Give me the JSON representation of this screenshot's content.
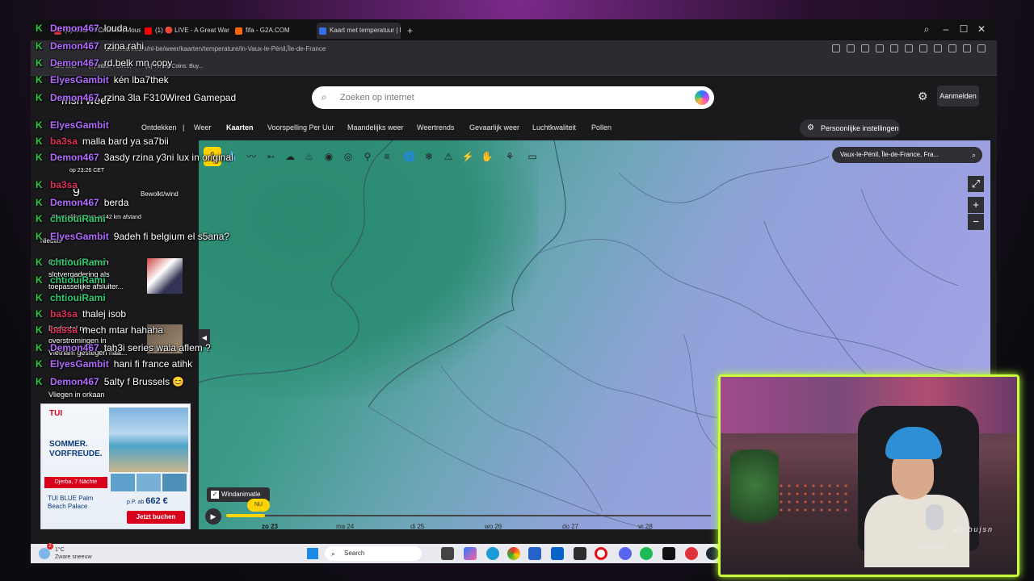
{
  "browser": {
    "tabs": [
      {
        "label": "(1) Deal Of Crashes, Mouse",
        "color": "#c33"
      },
      {
        "label": "(1) 🔴 LIVE - A Great War",
        "color": "#f00"
      },
      {
        "label": "fifa - G2A.COM",
        "color": "#f60"
      },
      {
        "label": "Kaart met temperatuur | M",
        "color": "#3a6ee8"
      }
    ],
    "url": "www.msn.com/nl-be/weer/kaarten/temperature/in-Vaux-le-Pénil,Île-de-France",
    "bookmarks": [
      "safe deal",
      "(7) Inbox • Direct",
      "(6) TikTok Coins: Buy..."
    ],
    "window_controls": [
      "search-icon",
      "minimize-icon",
      "maximize-icon",
      "close-icon"
    ]
  },
  "msn": {
    "logo_text": "msn weer",
    "search_placeholder": "Zoeken op internet",
    "signin_label": "Aanmelden",
    "personal_settings": "Persoonlijke instellingen",
    "nav": [
      "Ontdekken",
      "Weer",
      "Kaarten",
      "Voorspelling Per Uur",
      "Maandelijks weer",
      "Weertrends",
      "Gevaarlijk weer",
      "Luchtkwaliteit",
      "Pollen"
    ],
    "active_nav": "Kaarten"
  },
  "map": {
    "location": "Vaux-le-Pénil, Île-de-France, Fra...",
    "tools": [
      "thermometer-icon",
      "droplet-icon",
      "wind-icon",
      "wind-arrow-icon",
      "cloud-icon",
      "humidity-icon",
      "visibility-icon",
      "pressure-icon",
      "pin-icon",
      "fog-icon",
      "hurricane-icon",
      "snow-icon",
      "warning-icon",
      "lightning-icon",
      "fire-icon",
      "pollen-icon",
      "chat-icon"
    ],
    "wind_animation_label": "Windanimatie",
    "wind_animation_checked": true,
    "now_label": "NU",
    "days": [
      "zo 23",
      "ma 24",
      "di 25",
      "wo 26",
      "do 27",
      "vr 28"
    ],
    "fullscreen_icon": "expand-icon",
    "zoom_in": "+",
    "zoom_out": "−",
    "colors": {
      "sea": "#2f8e76",
      "land_warm": "#6ea6b8",
      "land_cold": "#a7a6e6",
      "accent": "#ffd400"
    }
  },
  "sidebar_bleed": {
    "time_text": "op 23:26 CET",
    "weather_text": "Bewolkt/wind",
    "temp": "9",
    "news_label": "Nieuws",
    "news_items": [
      "slotvergadering als",
      "toepasselijke afsluiter...",
      "Dodental na",
      "overstromingen in",
      "Vietnam gestegen naa...",
      "Vliegen in orkaan"
    ],
    "distance_text": "Plaatselijke regen op 42 km afstand",
    "cop_text": "COP29: Chaotisch"
  },
  "chat": [
    {
      "user": "Demon467",
      "text": "louda",
      "color": "#b36bff"
    },
    {
      "user": "Demon467",
      "text": "rzina rahi",
      "color": "#b36bff"
    },
    {
      "user": "Demon467",
      "text": "rd belk mn copy",
      "color": "#b36bff"
    },
    {
      "user": "ElyesGambit",
      "text": "kén lba7thek",
      "color": "#b36bff"
    },
    {
      "user": "Demon467",
      "text": "rzina 3la F310Wired Gamepad",
      "color": "#b36bff"
    },
    {
      "user": "ElyesGambit",
      "text": "",
      "color": "#b36bff"
    },
    {
      "user": "ba3sa",
      "text": "malla bard ya sa7bii",
      "color": "#e0305a"
    },
    {
      "user": "Demon467",
      "text": "3asdy rzina y3ni lux in original",
      "color": "#b36bff"
    },
    {
      "user": "ba3sa",
      "text": "",
      "color": "#e0305a"
    },
    {
      "user": "Demon467",
      "text": "berda",
      "color": "#b36bff"
    },
    {
      "user": "chtiouiRami",
      "text": "",
      "color": "#2ecc71"
    },
    {
      "user": "ElyesGambit",
      "text": "9adeh fi belgium el s5ana?",
      "color": "#b36bff"
    },
    {
      "user": "chtiouiRami",
      "text": "",
      "color": "#2ecc71"
    },
    {
      "user": "chtiouiRami",
      "text": "",
      "color": "#2ecc71"
    },
    {
      "user": "chtiouiRami",
      "text": "",
      "color": "#2ecc71"
    },
    {
      "user": "ba3sa",
      "text": "thalej isob",
      "color": "#e0305a"
    },
    {
      "user": "ba3sa",
      "text": "mech mtar hahaha",
      "color": "#e0305a"
    },
    {
      "user": "Demon467",
      "text": "tah3i series wala aflem ?",
      "color": "#b36bff"
    },
    {
      "user": "ElyesGambit",
      "text": "hani fi france atihk",
      "color": "#b36bff"
    },
    {
      "user": "Demon467",
      "text": "5alty f Brussels 😊",
      "color": "#b36bff"
    }
  ],
  "ad": {
    "brand": "TUI",
    "headline": "SOMMER. VORFREUDE.",
    "destination": "Djerba, 7 Nächte",
    "hotel_line1": "TUI BLUE Palm",
    "hotel_line2": "Beach Palace",
    "price_prefix": "p.P. ab",
    "price": "662 €",
    "cta": "Jetzt buchen"
  },
  "taskbar": {
    "temp": "1°C",
    "condition": "Zware sneeuw",
    "badge": "2",
    "search_label": "Search",
    "icons": [
      "file-explorer-icon",
      "copilot-icon",
      "edge-icon",
      "chrome-icon",
      "store-icon",
      "outlook-icon",
      "terminal-icon",
      "opera-icon",
      "discord-icon",
      "spotify-icon",
      "capcut-icon",
      "app-icon",
      "steam-icon"
    ]
  },
  "webcam": {
    "watermark": "up bujsn",
    "date_ghost": "11/22/2024"
  }
}
